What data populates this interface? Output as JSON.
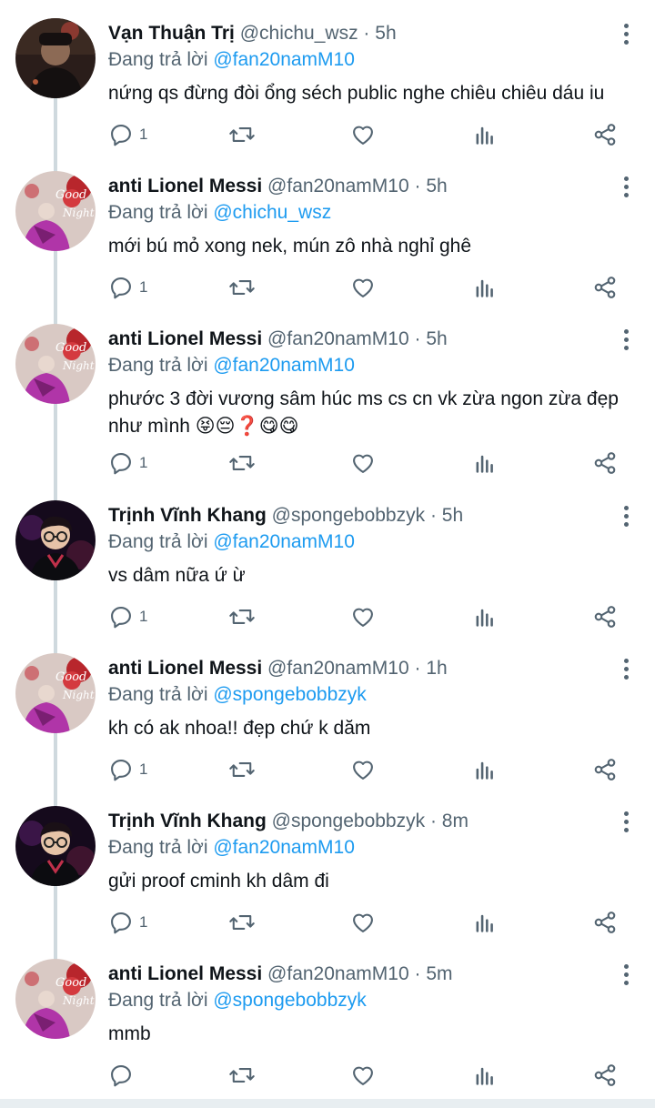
{
  "tweets": [
    {
      "name": "Vạn Thuận Trị",
      "handle": "@chichu_wsz",
      "time": "5h",
      "reply_prefix": "Đang trả lời",
      "reply_to": "@fan20namM10",
      "text": "nứng qs đừng đòi ổng séch public nghe chiêu chiêu dáu iu",
      "reply_count": "1",
      "avatar": "man-dark"
    },
    {
      "name": "anti Lionel Messi",
      "handle": "@fan20namM10",
      "time": "5h",
      "reply_prefix": "Đang trả lời",
      "reply_to": "@chichu_wsz",
      "text": "mới bú mỏ xong nek, mún zô nhà nghỉ ghê",
      "reply_count": "1",
      "avatar": "good-night"
    },
    {
      "name": "anti Lionel Messi",
      "handle": "@fan20namM10",
      "time": "5h",
      "reply_prefix": "Đang trả lời",
      "reply_to": "@fan20namM10",
      "text": "phước 3 đời vương sâm húc ms cs cn vk zừa ngon zừa đẹp như mình 😝😔❓😋😋",
      "reply_count": "1",
      "avatar": "good-night"
    },
    {
      "name": "Trịnh Vĩnh Khang",
      "handle": "@spongebobbzyk",
      "time": "5h",
      "reply_prefix": "Đang trả lời",
      "reply_to": "@fan20namM10",
      "text": "vs dâm nữa ứ ừ",
      "reply_count": "1",
      "avatar": "boy-glasses"
    },
    {
      "name": "anti Lionel Messi",
      "handle": "@fan20namM10",
      "time": "1h",
      "reply_prefix": "Đang trả lời",
      "reply_to": "@spongebobbzyk",
      "text": "kh có ak nhoa!! đẹp chứ k dăm",
      "reply_count": "1",
      "avatar": "good-night"
    },
    {
      "name": "Trịnh Vĩnh Khang",
      "handle": "@spongebobbzyk",
      "time": "8m",
      "reply_prefix": "Đang trả lời",
      "reply_to": "@fan20namM10",
      "text": "gửi proof cminh kh dâm đi",
      "reply_count": "1",
      "avatar": "boy-glasses"
    },
    {
      "name": "anti Lionel Messi",
      "handle": "@fan20namM10",
      "time": "5m",
      "reply_prefix": "Đang trả lời",
      "reply_to": "@spongebobbzyk",
      "text": "mmb",
      "reply_count": "",
      "avatar": "good-night"
    }
  ],
  "icons": {
    "reply": "reply-icon",
    "retweet": "retweet-icon",
    "like": "heart-icon",
    "stats": "stats-icon",
    "share": "share-icon",
    "more": "more-vertical-icon"
  },
  "colors": {
    "link": "#1d9bf0",
    "secondary_text": "#536471",
    "thread_line": "#cfd9de"
  }
}
